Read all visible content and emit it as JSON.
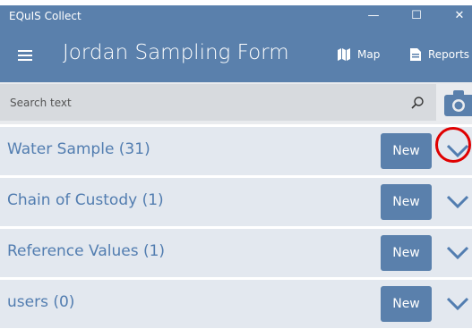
{
  "window": {
    "app_title": "EQuIS Collect",
    "controls": {
      "minimize": "—",
      "maximize": "☐",
      "close": "✕"
    }
  },
  "header": {
    "form_title": "Jordan Sampling Form",
    "map_label": "Map",
    "reports_label": "Reports"
  },
  "search": {
    "placeholder": "Search text",
    "value": ""
  },
  "sections": [
    {
      "label": "Water Sample (31)",
      "new_label": "New"
    },
    {
      "label": "Chain of Custody (1)",
      "new_label": "New"
    },
    {
      "label": "Reference Values (1)",
      "new_label": "New"
    },
    {
      "label": "users (0)",
      "new_label": "New"
    }
  ],
  "colors": {
    "accent": "#5a80ac",
    "row_bg": "#e3e8ef",
    "label_text": "#527db0",
    "highlight_circle": "#e00000"
  },
  "icons": {
    "menu": "hamburger-icon",
    "map": "map-icon",
    "reports": "document-icon",
    "search": "search-icon",
    "camera": "camera-icon",
    "expand": "chevron-down-icon"
  }
}
